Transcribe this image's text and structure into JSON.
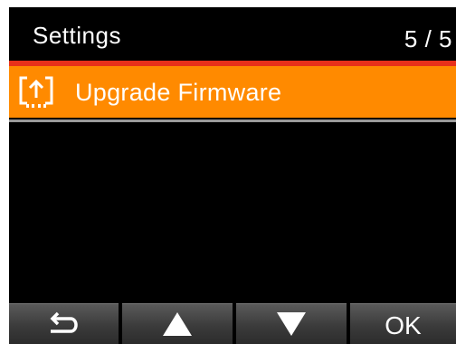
{
  "header": {
    "title": "Settings",
    "page_indicator": "5 / 5"
  },
  "menu": {
    "items": [
      {
        "label": "Upgrade Firmware",
        "icon": "firmware-upgrade-icon",
        "selected": true
      }
    ]
  },
  "softkeys": {
    "back_icon": "back-arrow-icon",
    "up_icon": "up-triangle-icon",
    "down_icon": "down-triangle-icon",
    "ok_label": "OK"
  },
  "colors": {
    "background": "#000000",
    "header_rule": "#e8301a",
    "selected_item": "#ff8a00",
    "text": "#ffffff"
  }
}
